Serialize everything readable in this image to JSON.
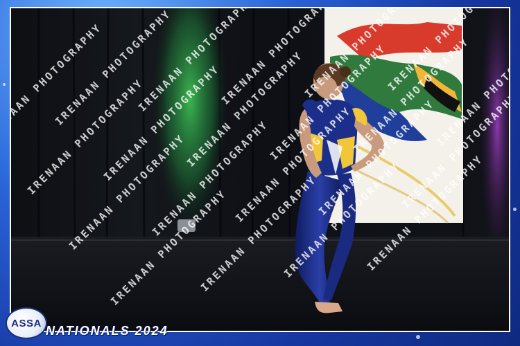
{
  "photo": {
    "description_icon": "dancer-photo",
    "watermark_text": "IRENAAN PHOTOGRAPHY",
    "flag_colors": [
      "#d83a2c",
      "#2f7a3c",
      "#1f3f9a",
      "#f2b53a",
      "#111111",
      "#ffffff"
    ]
  },
  "branding": {
    "logo_text": "ASSA",
    "event_title": "NATIONALS 2024"
  },
  "colors": {
    "frame_blue": "#1a3fa0",
    "costume_blue": "#1b2f8a",
    "costume_yellow": "#f2c63a",
    "curtain_green": "#1f7a3a"
  }
}
